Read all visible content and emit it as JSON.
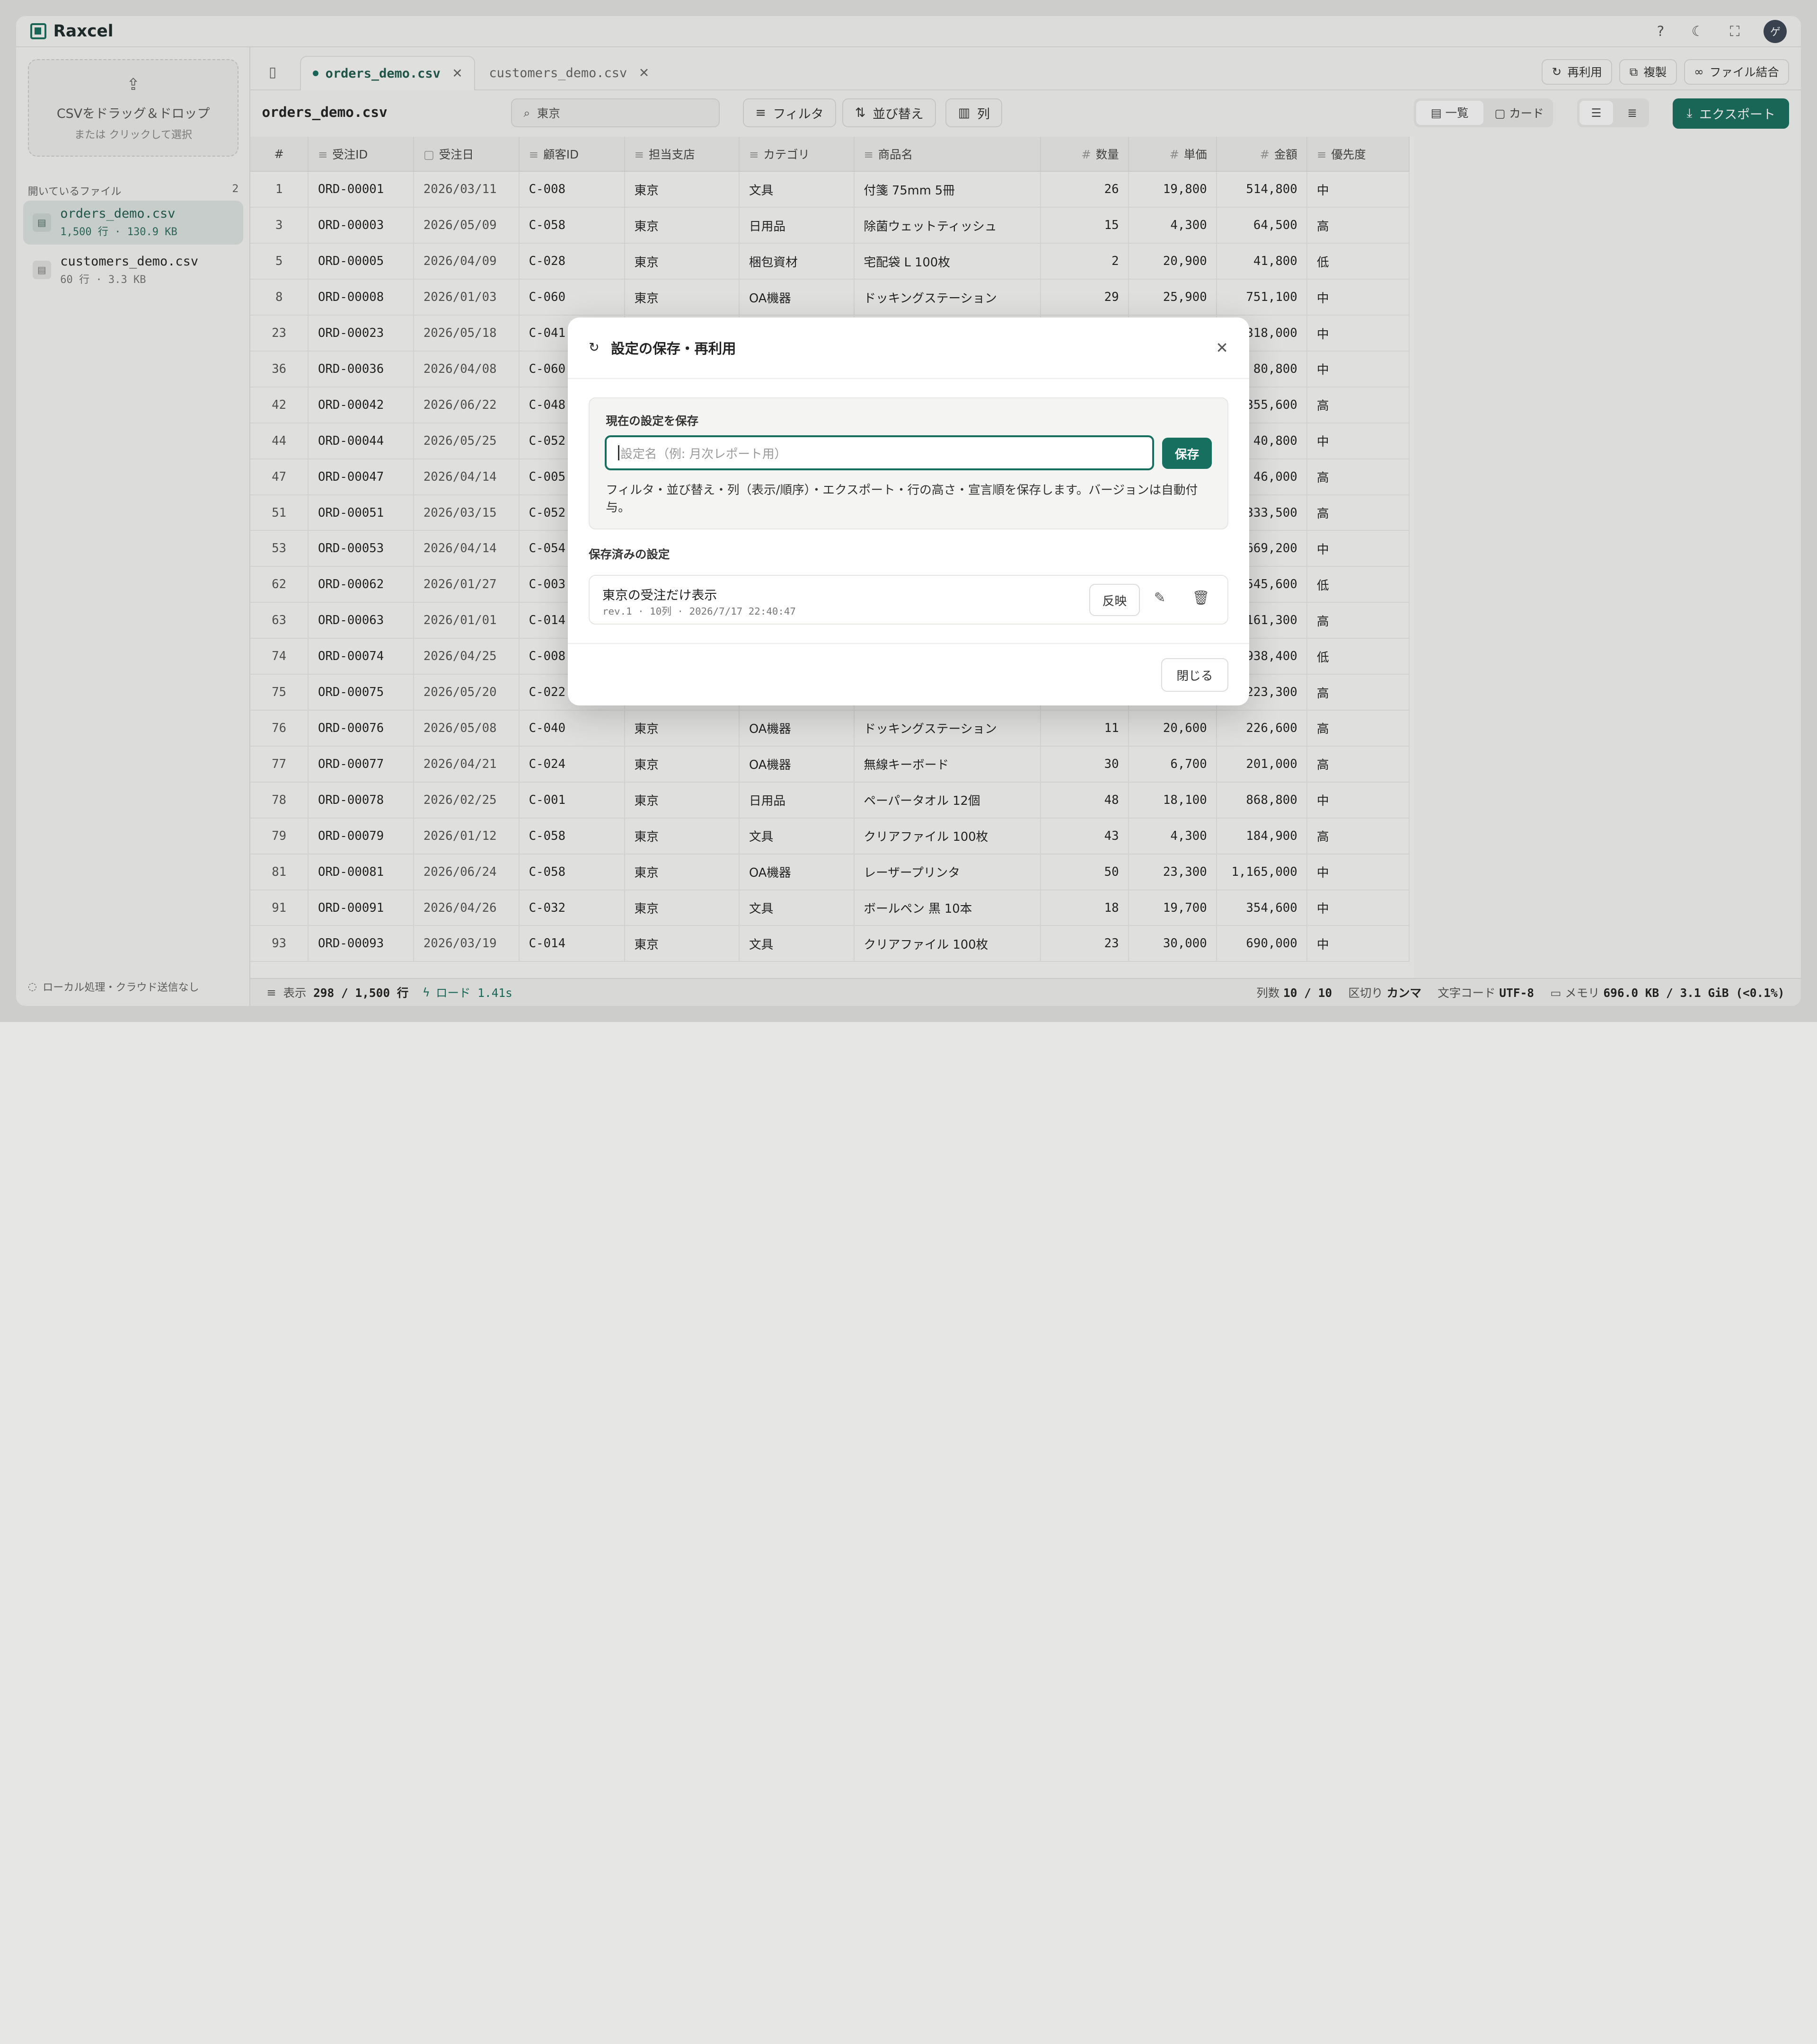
{
  "app": {
    "name": "Raxcel"
  },
  "avatar_letter": "ゲ",
  "sidebar": {
    "dropzone_line1": "CSVをドラッグ＆ドロップ",
    "dropzone_line2": "または クリックして選択",
    "open_files_label": "開いているファイル",
    "open_files_count": "2",
    "files": [
      {
        "name": "orders_demo.csv",
        "meta": "1,500 行 · 130.9 KB",
        "active": true
      },
      {
        "name": "customers_demo.csv",
        "meta": "60 行 · 3.3 KB",
        "active": false
      }
    ],
    "footer": "ローカル処理・クラウド送信なし"
  },
  "tabs": [
    {
      "label": "orders_demo.csv",
      "active": true
    },
    {
      "label": "customers_demo.csv",
      "active": false
    }
  ],
  "tab_actions": {
    "reuse": "再利用",
    "duplicate": "複製",
    "merge": "ファイル結合"
  },
  "toolbar": {
    "title": "orders_demo.csv",
    "search_value": "東京",
    "filter": "フィルタ",
    "sort": "並び替え",
    "columns": "列",
    "view_list": "一覧",
    "view_card": "カード",
    "export": "エクスポート"
  },
  "table": {
    "headers": [
      "#",
      "受注ID",
      "受注日",
      "顧客ID",
      "担当支店",
      "カテゴリ",
      "商品名",
      "数量",
      "単価",
      "金額",
      "優先度"
    ],
    "rows": [
      [
        "1",
        "ORD-00001",
        "2026/03/11",
        "C-008",
        "東京",
        "文具",
        "付箋 75mm 5冊",
        "26",
        "19,800",
        "514,800",
        "中"
      ],
      [
        "3",
        "ORD-00003",
        "2026/05/09",
        "C-058",
        "東京",
        "日用品",
        "除菌ウェットティッシュ",
        "15",
        "4,300",
        "64,500",
        "高"
      ],
      [
        "5",
        "ORD-00005",
        "2026/04/09",
        "C-028",
        "東京",
        "梱包資材",
        "宅配袋 L 100枚",
        "2",
        "20,900",
        "41,800",
        "低"
      ],
      [
        "8",
        "ORD-00008",
        "2026/01/03",
        "C-060",
        "東京",
        "OA機器",
        "ドッキングステーション",
        "29",
        "25,900",
        "751,100",
        "中"
      ],
      [
        "23",
        "ORD-00023",
        "2026/05/18",
        "C-041",
        "",
        "",
        "",
        "",
        "",
        "318,000",
        "中"
      ],
      [
        "36",
        "ORD-00036",
        "2026/04/08",
        "C-060",
        "",
        "",
        "",
        "",
        "",
        "80,800",
        "中"
      ],
      [
        "42",
        "ORD-00042",
        "2026/06/22",
        "C-048",
        "",
        "",
        "",
        "",
        "",
        "355,600",
        "高"
      ],
      [
        "44",
        "ORD-00044",
        "2026/05/25",
        "C-052",
        "",
        "",
        "",
        "",
        "",
        "40,800",
        "中"
      ],
      [
        "47",
        "ORD-00047",
        "2026/04/14",
        "C-005",
        "",
        "",
        "",
        "",
        "",
        "46,000",
        "高"
      ],
      [
        "51",
        "ORD-00051",
        "2026/03/15",
        "C-052",
        "",
        "",
        "",
        "",
        "",
        "333,500",
        "高"
      ],
      [
        "53",
        "ORD-00053",
        "2026/04/14",
        "C-054",
        "",
        "",
        "",
        "",
        "",
        "669,200",
        "中"
      ],
      [
        "62",
        "ORD-00062",
        "2026/01/27",
        "C-003",
        "",
        "",
        "",
        "",
        "",
        "545,600",
        "低"
      ],
      [
        "63",
        "ORD-00063",
        "2026/01/01",
        "C-014",
        "",
        "",
        "",
        "",
        "",
        "161,300",
        "高"
      ],
      [
        "74",
        "ORD-00074",
        "2026/04/25",
        "C-008",
        "",
        "",
        "",
        "",
        "",
        "938,400",
        "低"
      ],
      [
        "75",
        "ORD-00075",
        "2026/05/20",
        "C-022",
        "",
        "",
        "",
        "",
        "",
        "223,300",
        "高"
      ],
      [
        "76",
        "ORD-00076",
        "2026/05/08",
        "C-040",
        "東京",
        "OA機器",
        "ドッキングステーション",
        "11",
        "20,600",
        "226,600",
        "高"
      ],
      [
        "77",
        "ORD-00077",
        "2026/04/21",
        "C-024",
        "東京",
        "OA機器",
        "無線キーボード",
        "30",
        "6,700",
        "201,000",
        "高"
      ],
      [
        "78",
        "ORD-00078",
        "2026/02/25",
        "C-001",
        "東京",
        "日用品",
        "ペーパータオル 12個",
        "48",
        "18,100",
        "868,800",
        "中"
      ],
      [
        "79",
        "ORD-00079",
        "2026/01/12",
        "C-058",
        "東京",
        "文具",
        "クリアファイル 100枚",
        "43",
        "4,300",
        "184,900",
        "高"
      ],
      [
        "81",
        "ORD-00081",
        "2026/06/24",
        "C-058",
        "東京",
        "OA機器",
        "レーザープリンタ",
        "50",
        "23,300",
        "1,165,000",
        "中"
      ],
      [
        "91",
        "ORD-00091",
        "2026/04/26",
        "C-032",
        "東京",
        "文具",
        "ボールペン 黒 10本",
        "18",
        "19,700",
        "354,600",
        "中"
      ],
      [
        "93",
        "ORD-00093",
        "2026/03/19",
        "C-014",
        "東京",
        "文具",
        "クリアファイル 100枚",
        "23",
        "30,000",
        "690,000",
        "中"
      ]
    ]
  },
  "status": {
    "display_label": "表示",
    "display_value": "298 / 1,500 行",
    "load": "ロード 1.41s",
    "cols_label": "列数",
    "cols_value": "10 / 10",
    "delim_label": "区切り",
    "delim_value": "カンマ",
    "encoding_label": "文字コード",
    "encoding_value": "UTF-8",
    "memory_label": "メモリ",
    "memory_value": "696.0 KB / 3.1 GiB (<0.1%)"
  },
  "modal": {
    "title": "設定の保存・再利用",
    "save_section_label": "現在の設定を保存",
    "name_placeholder": "設定名（例: 月次レポート用）",
    "save_button": "保存",
    "help_text": "フィルタ・並び替え・列（表示/順序）・エクスポート・行の高さ・宣言順を保存します。バージョンは自動付与。",
    "saved_label": "保存済みの設定",
    "saved_items": [
      {
        "name": "東京の受注だけ表示",
        "meta": "rev.1 · 10列 · 2026/7/17 22:40:47",
        "apply": "反映"
      }
    ],
    "close_button": "閉じる"
  },
  "colors": {
    "accent": "#17705f"
  }
}
